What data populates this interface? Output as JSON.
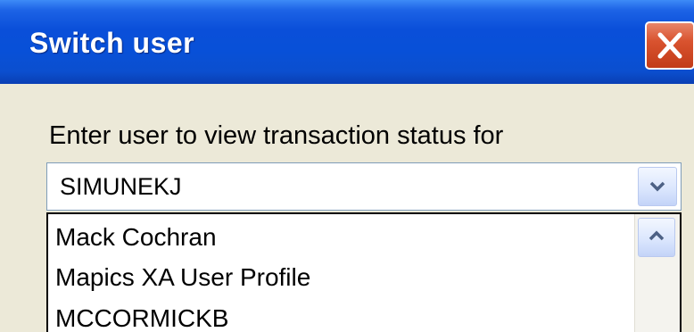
{
  "dialog": {
    "title": "Switch user",
    "prompt": "Enter user to view transaction status for"
  },
  "user_combo": {
    "selected_value": "SIMUNEKJ"
  },
  "dropdown_list": {
    "items": [
      {
        "label": "Mack Cochran"
      },
      {
        "label": "Mapics XA User Profile"
      },
      {
        "label": "MCCORMICKB"
      }
    ]
  },
  "icons": {
    "close": "close-icon",
    "dropdown": "chevron-down-icon",
    "scroll_up": "chevron-up-icon"
  },
  "colors": {
    "titlebar": "#0a4fd9",
    "close_button": "#d9532f",
    "dialog_background": "#ece9d8"
  }
}
